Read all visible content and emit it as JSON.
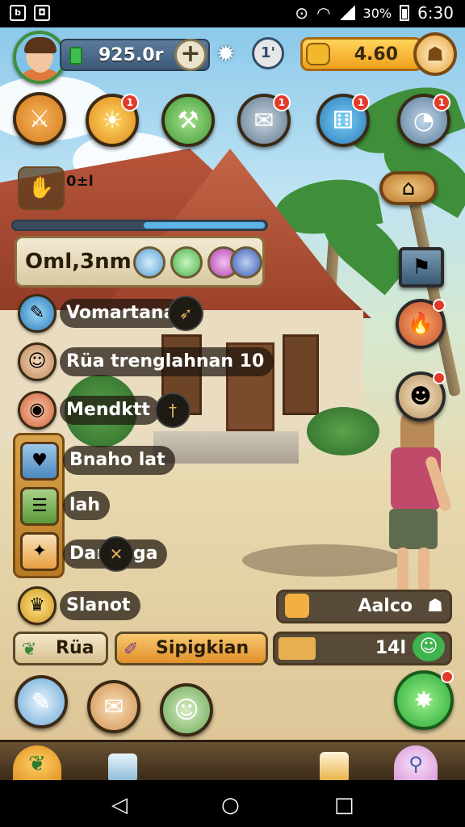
{
  "status_bar": {
    "left_icons": [
      "ink-icon",
      "image-icon"
    ],
    "battery_text": "30%",
    "time": "6:30"
  },
  "hud": {
    "coins": "925.0r",
    "plus_label": "+",
    "level": "1'",
    "gold": "4.60",
    "colors": {
      "gold": "#f0a11e",
      "coin_bar": "#4a6a8a"
    }
  },
  "top_icons": [
    {
      "name": "sword",
      "badge": ""
    },
    {
      "name": "sun",
      "badge": "1"
    },
    {
      "name": "hammer",
      "badge": ""
    },
    {
      "name": "map",
      "badge": "1"
    },
    {
      "name": "dice",
      "badge": "1"
    },
    {
      "name": "world",
      "badge": "1"
    }
  ],
  "resource_tag": {
    "value": "0±l"
  },
  "main_panel": {
    "title": "Oml,3nm"
  },
  "quest_rows": [
    {
      "label": "Vomartana",
      "icon": "hammer-icon",
      "tip_icon": "arrow-icon"
    },
    {
      "label": "Rüa trenglahnan 10",
      "icon": "avatar-icon",
      "tip_icon": ""
    },
    {
      "label": "Mendktt",
      "icon": "food-icon",
      "tip_icon": "dagger-icon"
    },
    {
      "label": "Bnaho lat",
      "icon": "pig-icon",
      "tip_icon": ""
    },
    {
      "label": "lah",
      "icon": "potion-icon",
      "tip_icon": ""
    },
    {
      "label": "Dan lega",
      "icon": "carrot-icon",
      "tip_icon": "cross-icon"
    },
    {
      "label": "Slanot",
      "icon": "trophy-icon",
      "tip_icon": ""
    }
  ],
  "right_bar": {
    "label": "Aalco"
  },
  "bottom_pills": {
    "left": "Rüa",
    "middle": "Sipigkian",
    "right_value": "14l"
  },
  "nav": {
    "back": "◁",
    "home": "○",
    "recent": "□"
  }
}
